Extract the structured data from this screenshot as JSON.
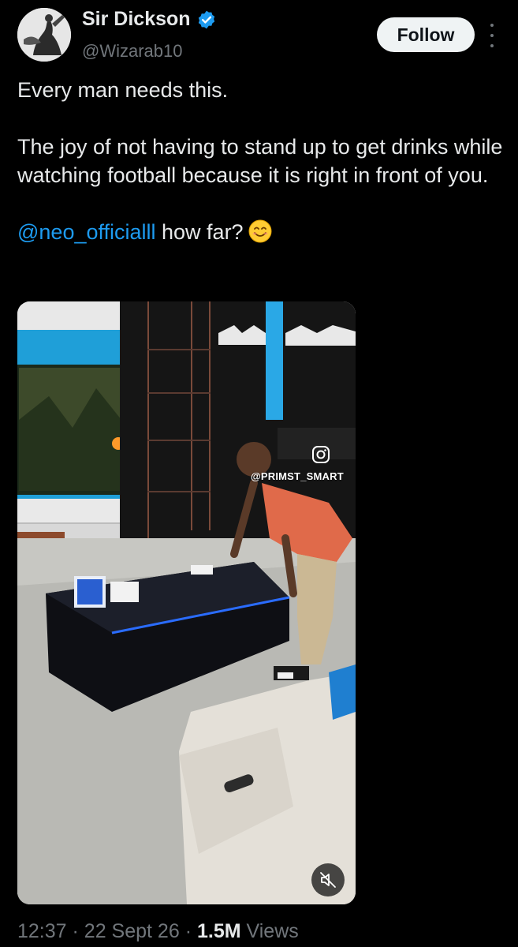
{
  "author": {
    "display_name": "Sir Dickson",
    "handle": "@Wizarab10",
    "verified": true,
    "avatar_icon": "avatar-photo"
  },
  "header": {
    "follow_label": "Follow",
    "more_icon": "more-vertical-icon"
  },
  "tweet": {
    "line1": "Every man needs this.",
    "line2": "The joy of not having to stand up to get drinks while watching football because it is right in front of you.",
    "mention": "@neo_officialll",
    "line3_rest": " how far?",
    "emoji": "smiling-face-icon"
  },
  "media": {
    "type": "video",
    "watermark": "@PRIMST_SMART",
    "overlay_icons": [
      "instagram-icon",
      "muted-speaker-icon"
    ]
  },
  "meta": {
    "time": "12:37",
    "separator": "·",
    "date": "22 Sept 26",
    "views_count": "1.5M",
    "views_label": "Views"
  },
  "colors": {
    "background": "#000000",
    "text": "#e7e9ea",
    "secondary_text": "#71767b",
    "link": "#1d9bf0",
    "verified": "#1d9bf0",
    "follow_bg": "#eff3f4"
  }
}
